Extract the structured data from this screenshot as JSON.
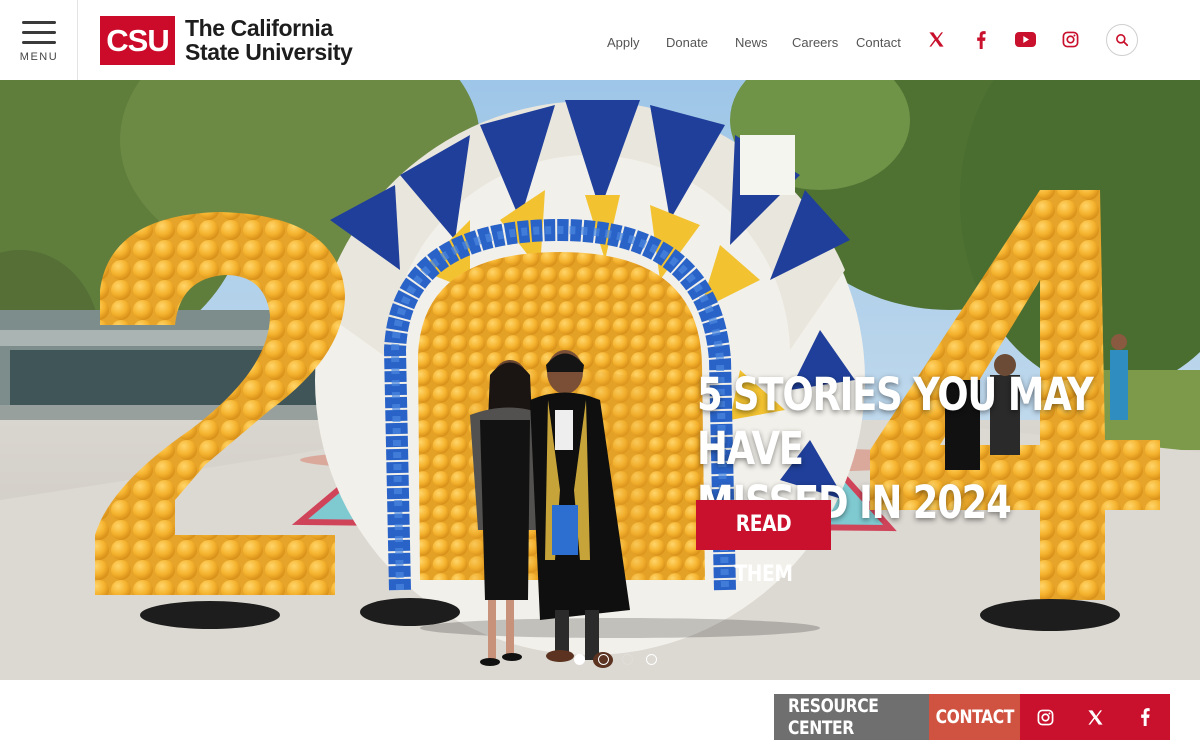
{
  "header": {
    "menu_label": "MENU",
    "logo_mark": "CSU",
    "logo_line1": "The California",
    "logo_line2": "State University",
    "nav": [
      "Apply",
      "Donate",
      "News",
      "Careers",
      "Contact"
    ],
    "social_icons": [
      "x-icon",
      "facebook-icon",
      "youtube-icon",
      "instagram-icon"
    ],
    "search_icon": "search-icon",
    "accent_color": "#cc0b2a"
  },
  "hero": {
    "headline_line1": "5 STORIES YOU MAY HAVE",
    "headline_line2": "MISSED IN 2024",
    "cta_label": "READ THEM",
    "slide_count": 4,
    "active_slide": 1
  },
  "action_bar": {
    "resource_label": "RESOURCE CENTER",
    "contact_label": "CONTACT",
    "icons": [
      "instagram-icon",
      "x-icon",
      "facebook-icon"
    ],
    "colors": {
      "resource": "#6f6f6f",
      "contact": "#d05341",
      "social": "#c9102c"
    }
  }
}
